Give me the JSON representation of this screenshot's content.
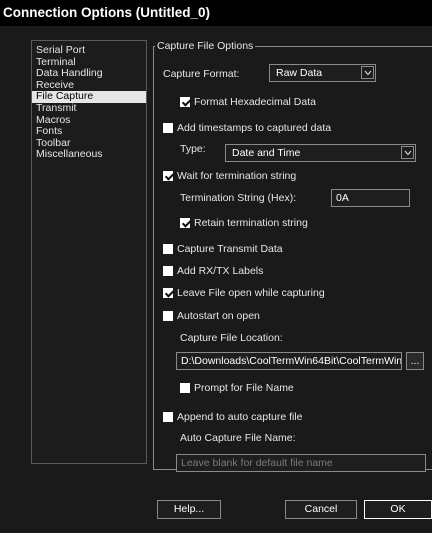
{
  "window": {
    "title": "Connection Options (Untitled_0)"
  },
  "nav": {
    "items": [
      {
        "label": "Serial Port"
      },
      {
        "label": "Terminal"
      },
      {
        "label": "Data Handling"
      },
      {
        "label": "Receive"
      },
      {
        "label": "File Capture"
      },
      {
        "label": "Transmit"
      },
      {
        "label": "Macros"
      },
      {
        "label": "Fonts"
      },
      {
        "label": "Toolbar"
      },
      {
        "label": "Miscellaneous"
      }
    ],
    "selected": "File Capture"
  },
  "capture": {
    "group_label": "Capture File Options",
    "format_label": "Capture Format:",
    "format_value": "Raw Data",
    "format_hex_label": "Format Hexadecimal Data",
    "format_hex_checked": true,
    "timestamps_label": "Add timestamps to captured data",
    "timestamps_checked": false,
    "type_label": "Type:",
    "type_value": "Date and Time",
    "wait_label": "Wait for termination string",
    "wait_checked": true,
    "term_label": "Termination String (Hex):",
    "term_value": "0A",
    "retain_label": "Retain termination string",
    "retain_checked": true,
    "transmit_label": "Capture Transmit Data",
    "transmit_checked": false,
    "rxtx_label": "Add RX/TX Labels",
    "rxtx_checked": false,
    "leave_open_label": "Leave File open while capturing",
    "leave_open_checked": true,
    "autostart_label": "Autostart on open",
    "autostart_checked": false,
    "location_label": "Capture File Location:",
    "location_value": "D:\\Downloads\\CoolTermWin64Bit\\CoolTermWin",
    "browse_label": "...",
    "prompt_label": "Prompt for File Name",
    "prompt_checked": false,
    "append_label": "Append to auto capture file",
    "append_checked": false,
    "auto_name_label": "Auto Capture File Name:",
    "auto_name_placeholder": "Leave blank for default file name"
  },
  "buttons": {
    "help": "Help...",
    "cancel": "Cancel",
    "ok": "OK"
  }
}
